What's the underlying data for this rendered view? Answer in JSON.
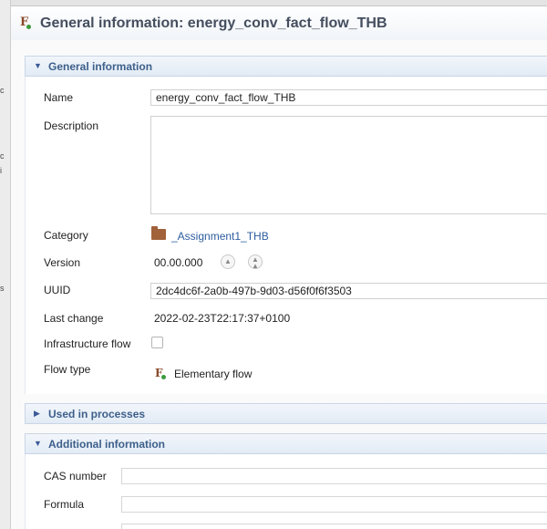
{
  "editor": {
    "title": "General information: energy_conv_fact_flow_THB"
  },
  "left_strip": [
    "c",
    "i",
    "s"
  ],
  "sections": {
    "general": {
      "heading": "General information",
      "expanded": true,
      "fields": {
        "name": {
          "label": "Name",
          "value": "energy_conv_fact_flow_THB"
        },
        "description": {
          "label": "Description",
          "value": ""
        },
        "category": {
          "label": "Category",
          "value": "_Assignment1_THB"
        },
        "version": {
          "label": "Version",
          "value": "00.00.000"
        },
        "uuid": {
          "label": "UUID",
          "value": "2dc4dc6f-2a0b-497b-9d03-d56f0f6f3503"
        },
        "last_change": {
          "label": "Last change",
          "value": "2022-02-23T22:17:37+0100"
        },
        "infrastructure_flow": {
          "label": "Infrastructure flow",
          "checked": false
        },
        "flow_type": {
          "label": "Flow type",
          "value": "Elementary flow"
        }
      }
    },
    "used_in_processes": {
      "heading": "Used in processes",
      "expanded": false
    },
    "additional": {
      "heading": "Additional information",
      "expanded": true,
      "fields": {
        "cas_number": {
          "label": "CAS number",
          "value": ""
        },
        "formula": {
          "label": "Formula",
          "value": ""
        }
      }
    }
  },
  "icons": {
    "flow": "flow-icon",
    "folder": "folder-icon",
    "spin_up": "arrow-up-icon",
    "spin_up_alt": "arrow-up-double-icon"
  },
  "colors": {
    "section_heading_text": "#3d5f8a",
    "link": "#2d5d9f",
    "folder": "#a0613b",
    "flow_icon_dot": "#3c9a3c"
  }
}
